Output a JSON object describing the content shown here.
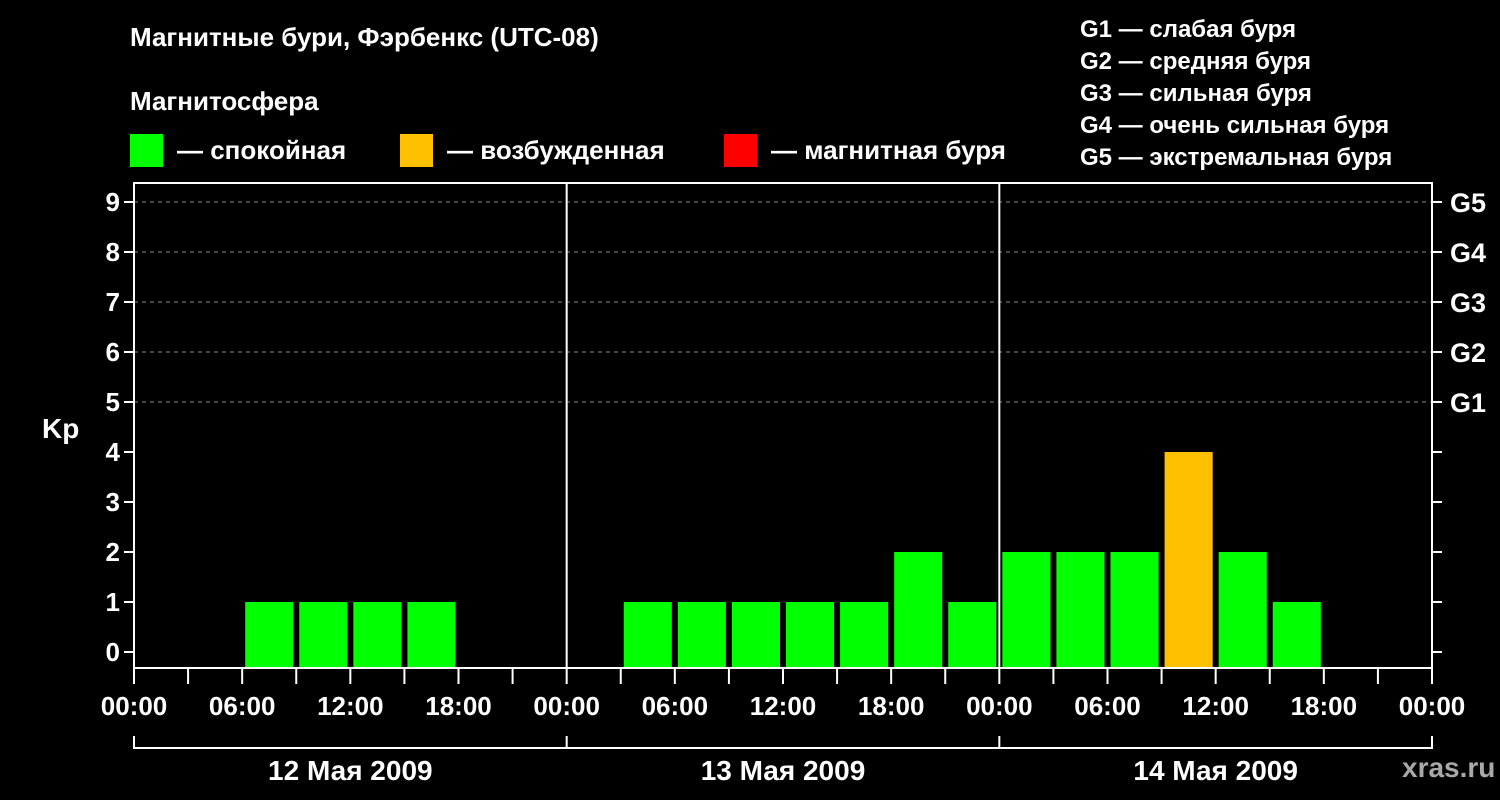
{
  "title": "Магнитные бури, Фэрбенкс (UTC-08)",
  "subtitle": "Магнитосфера",
  "legend": [
    {
      "label": "— спокойная",
      "color": "#00ff00"
    },
    {
      "label": "— возбужденная",
      "color": "#ffc000"
    },
    {
      "label": "— магнитная буря",
      "color": "#ff0000"
    }
  ],
  "g_legend": [
    "G1 — слабая буря",
    "G2 — средняя буря",
    "G3 — сильная буря",
    "G4 — очень сильная буря",
    "G5 — экстремальная буря"
  ],
  "watermark": "xras.ru",
  "chart_data": {
    "type": "bar",
    "ylabel": "Kp",
    "ylim": [
      0,
      9
    ],
    "yticks": [
      0,
      1,
      2,
      3,
      4,
      5,
      6,
      7,
      8,
      9
    ],
    "right_axis_labels": [
      {
        "kp": 5,
        "label": "G1"
      },
      {
        "kp": 6,
        "label": "G2"
      },
      {
        "kp": 7,
        "label": "G3"
      },
      {
        "kp": 8,
        "label": "G4"
      },
      {
        "kp": 9,
        "label": "G5"
      }
    ],
    "grid": "dashed horizontal at Kp 5–9",
    "x_tick_labels": [
      "00:00",
      "06:00",
      "12:00",
      "18:00",
      "00:00",
      "06:00",
      "12:00",
      "18:00",
      "00:00",
      "06:00",
      "12:00",
      "18:00",
      "00:00"
    ],
    "days": [
      "12 Мая 2009",
      "13 Мая 2009",
      "14 Мая 2009"
    ],
    "interval_hours": 3,
    "colors": {
      "quiet": "#00ff00",
      "unsettled": "#ffc000",
      "storm": "#ff0000"
    },
    "values": [
      null,
      null,
      1,
      1,
      1,
      1,
      null,
      null,
      null,
      1,
      1,
      1,
      1,
      1,
      2,
      1,
      2,
      2,
      2,
      4,
      2,
      1,
      null,
      null
    ]
  }
}
